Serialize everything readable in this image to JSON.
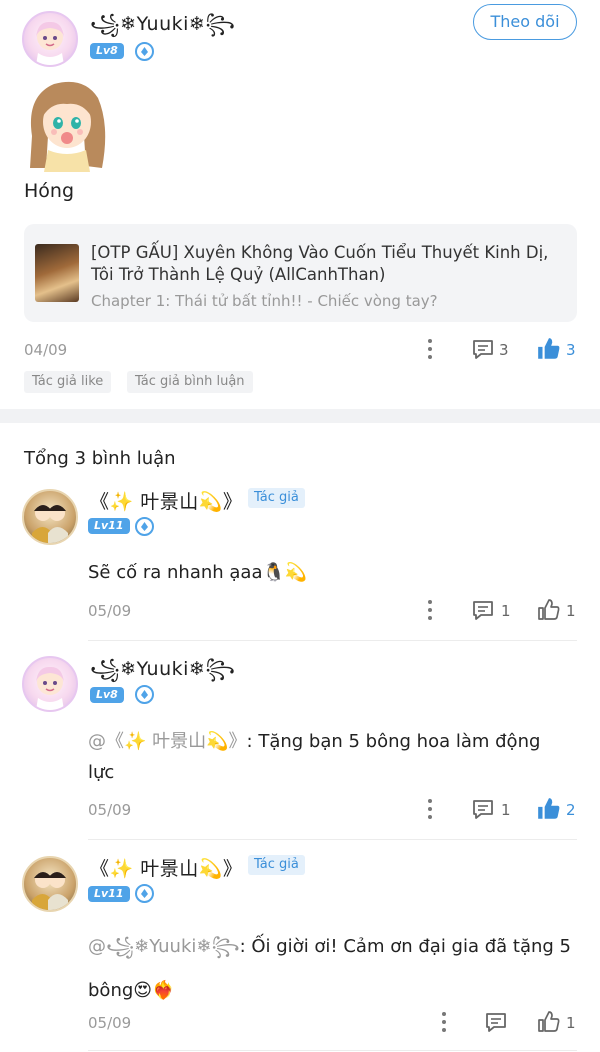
{
  "post": {
    "author": "꧁❄Yuuki❄꧂",
    "level": "Lv8",
    "follow_label": "Theo dõi",
    "text": "Hóng",
    "book": {
      "title": "[OTP GẤU] Xuyên Không Vào Cuốn Tiểu Thuyết Kinh Dị, Tôi Trở Thành Lệ Quỷ (AllCanhThan)",
      "chapter": "Chapter 1: Thái tử bất tỉnh!! - Chiếc vòng tay?"
    },
    "date": "04/09",
    "comment_count": "3",
    "like_count": "3",
    "tags": [
      "Tác giả like",
      "Tác giả bình luận"
    ]
  },
  "comments_header": "Tổng 3 bình luận",
  "comments": [
    {
      "author": "《✨ 叶景山💫》",
      "level": "Lv11",
      "author_tag": "Tác giả",
      "text": "Sẽ cố ra nhanh ạaa🐧💫",
      "date": "05/09",
      "reply_count": "1",
      "like_count": "1",
      "liked": false
    },
    {
      "author": "꧁❄Yuuki❄꧂",
      "level": "Lv8",
      "reply_to": "@《✨ 叶景山💫》",
      "text": ": Tặng bạn 5 bông hoa làm động lực",
      "date": "05/09",
      "reply_count": "1",
      "like_count": "2",
      "liked": true
    },
    {
      "author": "《✨ 叶景山💫》",
      "level": "Lv11",
      "author_tag": "Tác giả",
      "reply_to": "@꧁❄Yuuki❄꧂",
      "text": ": Ối giời ơi! Cảm ơn đại gia đã tặng 5 bông😍❤️‍🔥",
      "date": "05/09",
      "reply_count": "",
      "like_count": "1",
      "liked": false
    }
  ],
  "colors": {
    "accent": "#3b8fd9",
    "muted": "#9a9a9a",
    "card": "#f3f4f6"
  }
}
